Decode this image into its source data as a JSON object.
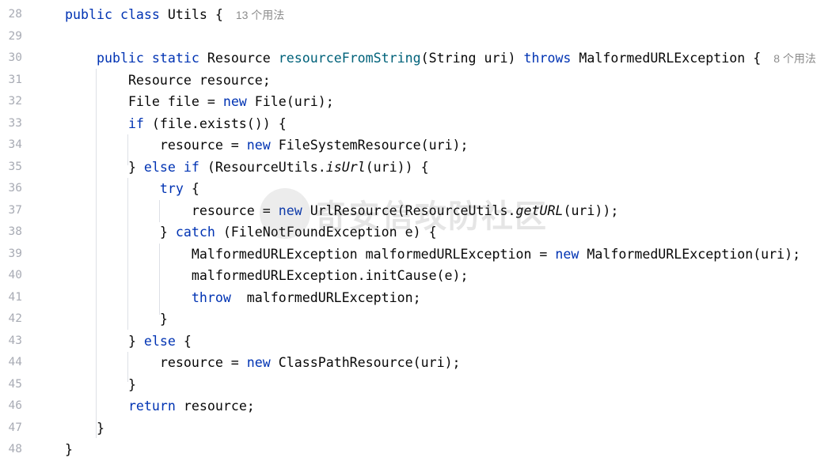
{
  "editor": {
    "lines": [
      {
        "num": "28",
        "indent": 0,
        "tokens": [
          {
            "t": "public",
            "c": "kw"
          },
          {
            "t": " "
          },
          {
            "t": "class",
            "c": "kw"
          },
          {
            "t": " Utils { "
          }
        ],
        "hint": "13 个用法"
      },
      {
        "num": "29",
        "indent": 0,
        "tokens": []
      },
      {
        "num": "30",
        "indent": 1,
        "tokens": [
          {
            "t": "public",
            "c": "kw"
          },
          {
            "t": " "
          },
          {
            "t": "static",
            "c": "kw"
          },
          {
            "t": " Resource "
          },
          {
            "t": "resourceFromString",
            "c": "fn"
          },
          {
            "t": "(String uri) "
          },
          {
            "t": "throws",
            "c": "kw"
          },
          {
            "t": " MalformedURLException { "
          }
        ],
        "hint": "8 个用法"
      },
      {
        "num": "31",
        "indent": 2,
        "tokens": [
          {
            "t": "Resource resource;"
          }
        ]
      },
      {
        "num": "32",
        "indent": 2,
        "tokens": [
          {
            "t": "File file = "
          },
          {
            "t": "new",
            "c": "kw"
          },
          {
            "t": " File(uri);"
          }
        ]
      },
      {
        "num": "33",
        "indent": 2,
        "tokens": [
          {
            "t": "if",
            "c": "kw"
          },
          {
            "t": " (file.exists()) {"
          }
        ]
      },
      {
        "num": "34",
        "indent": 3,
        "tokens": [
          {
            "t": "resource = "
          },
          {
            "t": "new",
            "c": "kw"
          },
          {
            "t": " FileSystemResource(uri);"
          }
        ]
      },
      {
        "num": "35",
        "indent": 2,
        "tokens": [
          {
            "t": "} "
          },
          {
            "t": "else",
            "c": "kw"
          },
          {
            "t": " "
          },
          {
            "t": "if",
            "c": "kw"
          },
          {
            "t": " (ResourceUtils."
          },
          {
            "t": "isUrl",
            "c": "it"
          },
          {
            "t": "(uri)) {"
          }
        ]
      },
      {
        "num": "36",
        "indent": 3,
        "tokens": [
          {
            "t": "try",
            "c": "kw"
          },
          {
            "t": " {"
          }
        ]
      },
      {
        "num": "37",
        "indent": 4,
        "tokens": [
          {
            "t": "resource = "
          },
          {
            "t": "new",
            "c": "kw"
          },
          {
            "t": " UrlResource(ResourceUtils."
          },
          {
            "t": "getURL",
            "c": "it"
          },
          {
            "t": "(uri));"
          }
        ]
      },
      {
        "num": "38",
        "indent": 3,
        "tokens": [
          {
            "t": "} "
          },
          {
            "t": "catch",
            "c": "kw"
          },
          {
            "t": " (FileNotFoundException e) {"
          }
        ]
      },
      {
        "num": "39",
        "indent": 4,
        "tokens": [
          {
            "t": "MalformedURLException malformedURLException = "
          },
          {
            "t": "new",
            "c": "kw"
          },
          {
            "t": " MalformedURLException(uri);"
          }
        ]
      },
      {
        "num": "40",
        "indent": 4,
        "tokens": [
          {
            "t": "malformedURLException.initCause(e);"
          }
        ]
      },
      {
        "num": "41",
        "indent": 4,
        "tokens": [
          {
            "t": "throw",
            "c": "kw"
          },
          {
            "t": "  malformedURLException;"
          }
        ]
      },
      {
        "num": "42",
        "indent": 3,
        "tokens": [
          {
            "t": "}"
          }
        ]
      },
      {
        "num": "43",
        "indent": 2,
        "tokens": [
          {
            "t": "} "
          },
          {
            "t": "else",
            "c": "kw"
          },
          {
            "t": " {"
          }
        ]
      },
      {
        "num": "44",
        "indent": 3,
        "tokens": [
          {
            "t": "resource = "
          },
          {
            "t": "new",
            "c": "kw"
          },
          {
            "t": " ClassPathResource(uri);"
          }
        ]
      },
      {
        "num": "45",
        "indent": 2,
        "tokens": [
          {
            "t": "}"
          }
        ]
      },
      {
        "num": "46",
        "indent": 2,
        "tokens": [
          {
            "t": "return",
            "c": "kw"
          },
          {
            "t": " resource;"
          }
        ]
      },
      {
        "num": "47",
        "indent": 1,
        "tokens": [
          {
            "t": "}"
          }
        ]
      },
      {
        "num": "48",
        "indent": 0,
        "tokens": [
          {
            "t": "}"
          }
        ]
      }
    ],
    "colors": {
      "keyword": "#0033b3",
      "method_declaration": "#00627a",
      "text": "#080808",
      "line_number": "#a8abb4",
      "usage_hint": "#8c8c8c",
      "indent_guide": "#dde0e6"
    }
  },
  "watermark": {
    "text": "奇安信攻防社区",
    "icon": "qianxin-logo-icon"
  }
}
